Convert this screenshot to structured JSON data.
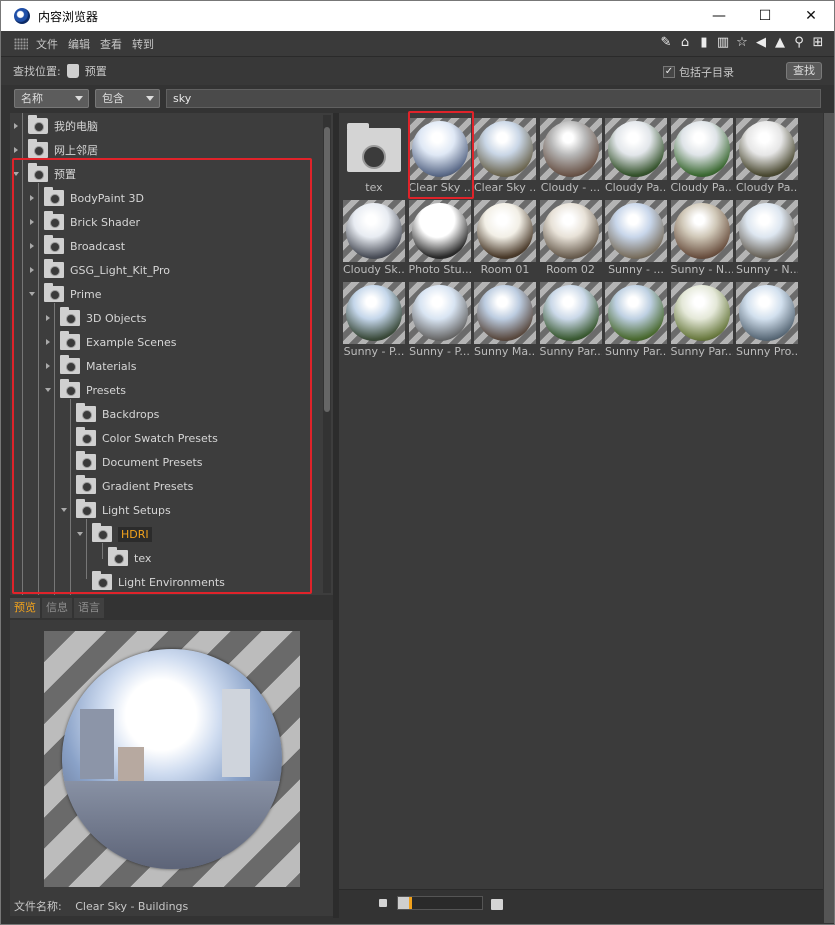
{
  "window": {
    "title": "内容浏览器",
    "minimize": "—",
    "maximize": "☐",
    "close": "✕"
  },
  "menu": [
    "文件",
    "编辑",
    "查看",
    "转到"
  ],
  "toolbar_icons": [
    "edit-icon",
    "home-icon",
    "bottle-icon",
    "book-icon",
    "star-icon",
    "back-icon",
    "up-icon",
    "search-icon",
    "plus-icon"
  ],
  "search": {
    "location_label": "查找位置:",
    "location_value": "预置",
    "include_subdirs_label": "包括子目录",
    "find_button": "查找"
  },
  "filter": {
    "field": "名称",
    "mode": "包含",
    "query": "sky"
  },
  "tree": [
    {
      "label": "我的电脑",
      "depth": 0,
      "icon": "computer-icon",
      "expanded": false
    },
    {
      "label": "网上邻居",
      "depth": 0,
      "icon": "network-icon",
      "expanded": false
    },
    {
      "label": "预置",
      "depth": 0,
      "icon": "presets-icon",
      "expanded": true
    },
    {
      "label": "BodyPaint 3D",
      "depth": 1,
      "expanded": false
    },
    {
      "label": "Brick Shader",
      "depth": 1,
      "expanded": false
    },
    {
      "label": "Broadcast",
      "depth": 1,
      "expanded": false
    },
    {
      "label": "GSG_Light_Kit_Pro",
      "depth": 1,
      "expanded": false
    },
    {
      "label": "Prime",
      "depth": 1,
      "expanded": true
    },
    {
      "label": "3D Objects",
      "depth": 2,
      "expanded": false
    },
    {
      "label": "Example Scenes",
      "depth": 2,
      "expanded": false
    },
    {
      "label": "Materials",
      "depth": 2,
      "expanded": false
    },
    {
      "label": "Presets",
      "depth": 2,
      "expanded": true
    },
    {
      "label": "Backdrops",
      "depth": 3
    },
    {
      "label": "Color Swatch Presets",
      "depth": 3
    },
    {
      "label": "Document Presets",
      "depth": 3
    },
    {
      "label": "Gradient Presets",
      "depth": 3
    },
    {
      "label": "Light Setups",
      "depth": 3,
      "expanded": true
    },
    {
      "label": "HDRI",
      "depth": 4,
      "expanded": true,
      "selected": true
    },
    {
      "label": "tex",
      "depth": 5
    },
    {
      "label": "Light Environments",
      "depth": 4
    }
  ],
  "tabs": [
    {
      "label": "预览",
      "active": true
    },
    {
      "label": "信息",
      "active": false
    },
    {
      "label": "语言",
      "active": false
    }
  ],
  "preview": {
    "filename_label": "文件名称:",
    "filename_value": "Clear Sky - Buildings"
  },
  "grid": [
    {
      "label": "tex",
      "type": "folder"
    },
    {
      "label": "Clear Sky ...",
      "type": "hdri",
      "highlight": true,
      "sky": "#dfe8f5",
      "ground": "#5b6a88"
    },
    {
      "label": "Clear Sky ...",
      "type": "hdri",
      "sky": "#c9d6e6",
      "ground": "#6c6650"
    },
    {
      "label": "Cloudy - ...",
      "type": "hdri",
      "sky": "#b8b8b8",
      "ground": "#6a5448"
    },
    {
      "label": "Cloudy Pa...",
      "type": "hdri",
      "sky": "#e2e6ea",
      "ground": "#35532c"
    },
    {
      "label": "Cloudy Pa...",
      "type": "hdri",
      "sky": "#dfe4e8",
      "ground": "#3c6a33"
    },
    {
      "label": "Cloudy Pa...",
      "type": "hdri",
      "sky": "#e6e6e6",
      "ground": "#4b4a32"
    },
    {
      "label": "Cloudy Sk...",
      "type": "hdri",
      "sky": "#e8ecf2",
      "ground": "#4a4e58"
    },
    {
      "label": "Photo Stu...",
      "type": "hdri",
      "sky": "#ffffff",
      "ground": "#2a2a2a"
    },
    {
      "label": "Room 01",
      "type": "hdri",
      "sky": "#f2efe6",
      "ground": "#4a3a2a"
    },
    {
      "label": "Room 02",
      "type": "hdri",
      "sky": "#e8e2d8",
      "ground": "#6a5e50"
    },
    {
      "label": "Sunny - ...",
      "type": "hdri",
      "sky": "#c8d6ea",
      "ground": "#7a7060"
    },
    {
      "label": "Sunny - N...",
      "type": "hdri",
      "sky": "#d0c8b8",
      "ground": "#6a5040"
    },
    {
      "label": "Sunny - N...",
      "type": "hdri",
      "sky": "#dde6f0",
      "ground": "#6a645a"
    },
    {
      "label": "Sunny - P...",
      "type": "hdri",
      "sky": "#c4d6ea",
      "ground": "#3a4a3a"
    },
    {
      "label": "Sunny - P...",
      "type": "hdri",
      "sky": "#d8e4f2",
      "ground": "#6a6a6a"
    },
    {
      "label": "Sunny Ma...",
      "type": "hdri",
      "sky": "#bccce0",
      "ground": "#5a4a40"
    },
    {
      "label": "Sunny Par...",
      "type": "hdri",
      "sky": "#cad8e8",
      "ground": "#3a5a32"
    },
    {
      "label": "Sunny Par...",
      "type": "hdri",
      "sky": "#bed0e2",
      "ground": "#4a6a30"
    },
    {
      "label": "Sunny Par...",
      "type": "hdri",
      "sky": "#e4e8d8",
      "ground": "#6a7a40"
    },
    {
      "label": "Sunny Pro...",
      "type": "hdri",
      "sky": "#d2e0ee",
      "ground": "#5a6a78"
    }
  ],
  "colors": {
    "accent": "#f2a21c",
    "highlight_border": "#e0232a",
    "panel": "#3b3b3b"
  }
}
